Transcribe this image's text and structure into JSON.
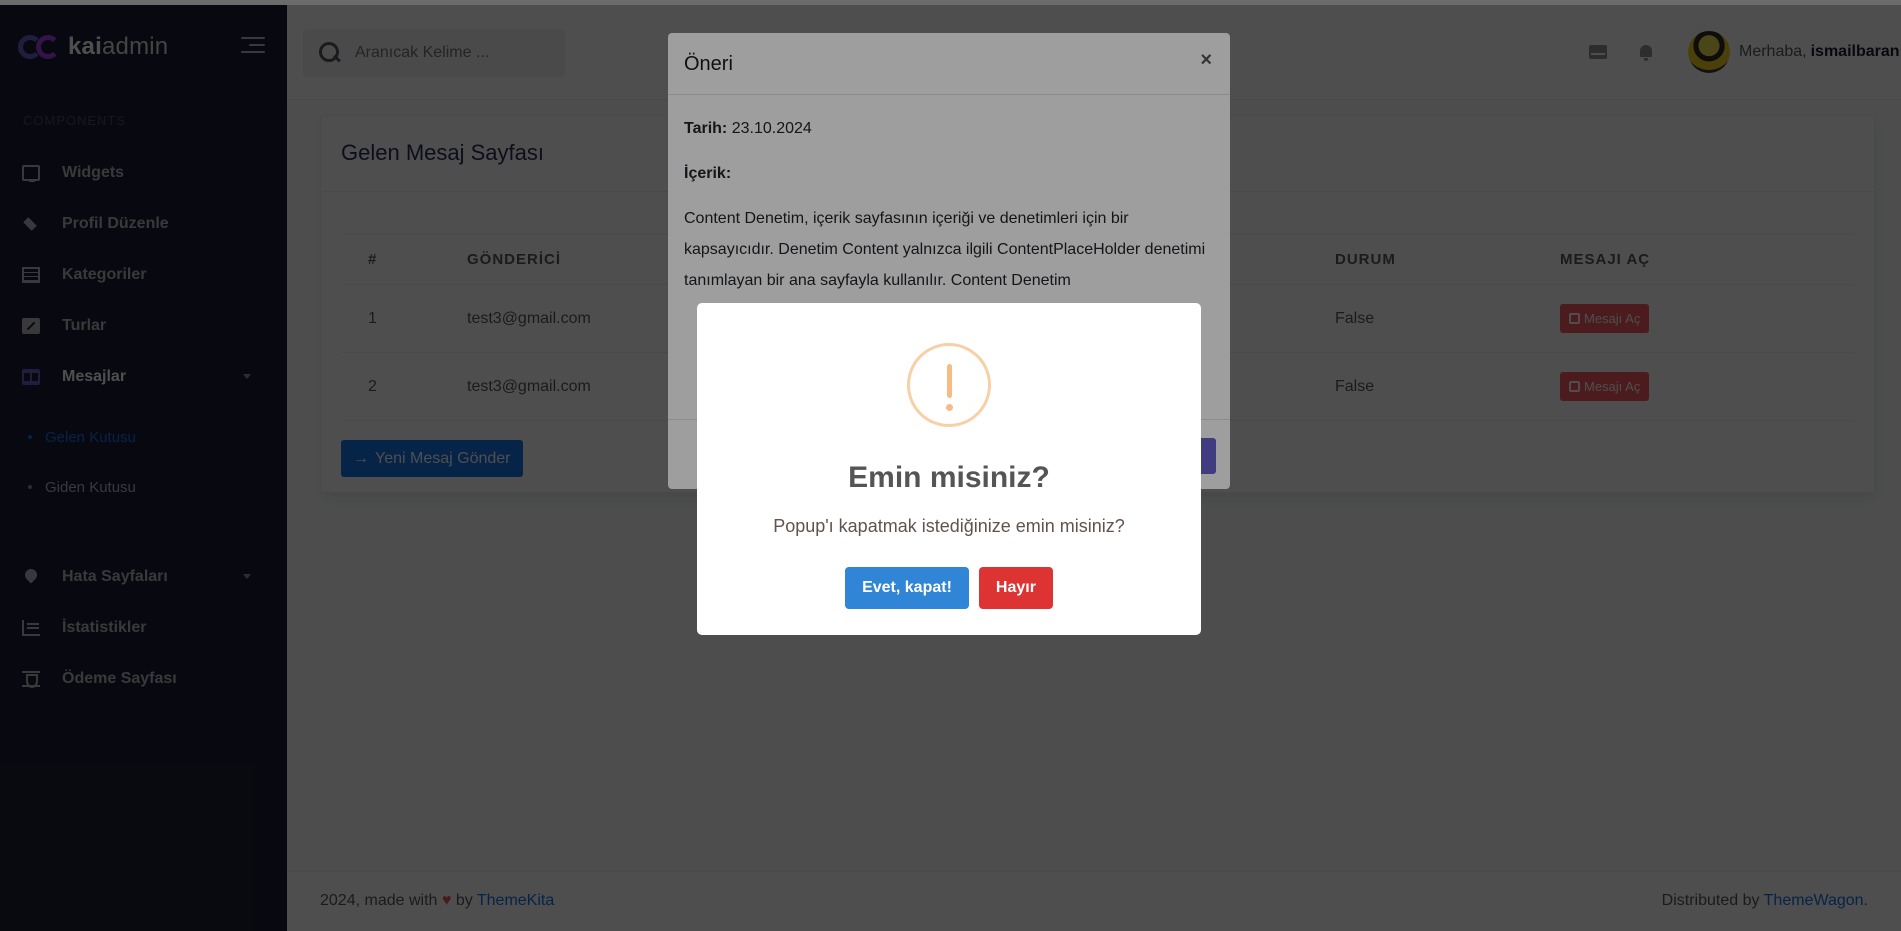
{
  "brand": {
    "logo_bold": "kai",
    "logo_light": "admin"
  },
  "sidebar": {
    "section_label": "COMPONENTS",
    "items": [
      {
        "label": "Widgets",
        "icon": "monitor-icon"
      },
      {
        "label": "Profil Düzenle",
        "icon": "layers-icon"
      },
      {
        "label": "Kategoriler",
        "icon": "table-icon"
      },
      {
        "label": "Turlar",
        "icon": "edit-icon"
      },
      {
        "label": "Mesajlar",
        "icon": "grid-icon"
      }
    ],
    "submenu": [
      {
        "label": "Gelen Kutusu"
      },
      {
        "label": "Giden Kutusu"
      }
    ],
    "items2": [
      {
        "label": "Hata Sayfaları",
        "icon": "map-pin-icon"
      },
      {
        "label": "İstatistikler",
        "icon": "chart-icon"
      },
      {
        "label": "Ödeme Sayfası",
        "icon": "hourglass-icon"
      }
    ]
  },
  "header": {
    "search_placeholder": "Aranıcak Kelime ...",
    "greeting": "Merhaba,",
    "username": "ismailbaran"
  },
  "card": {
    "title": "Gelen Mesaj Sayfası",
    "columns": [
      "#",
      "GÖNDERİCİ",
      "DURUM",
      "MESAJI AÇ"
    ],
    "rows": [
      {
        "num": "1",
        "sender": "test3@gmail.com",
        "status": "False",
        "action": "Mesajı Aç"
      },
      {
        "num": "2",
        "sender": "test3@gmail.com",
        "status": "False",
        "action": "Mesajı Aç"
      }
    ],
    "new_button": "Yeni Mesaj Gönder"
  },
  "footer": {
    "left_prefix": "2024, made with",
    "left_by": "by",
    "left_link": "ThemeKita",
    "right_prefix": "Distributed by",
    "right_link": "ThemeWagon",
    "right_suffix": "."
  },
  "modal": {
    "title": "Öneri",
    "close": "×",
    "date_label": "Tarih:",
    "date_value": "23.10.2024",
    "content_label": "İçerik:",
    "content_text": "Content Denetim, içerik sayfasının içeriği ve denetimleri için bir kapsayıcıdır. Denetim Content yalnızca ilgili ContentPlaceHolder denetimi tanımlayan bir ana sayfayla kullanılır. Content Denetim"
  },
  "alert": {
    "title": "Emin misiniz?",
    "text": "Popup'ı kapatmak istediğinize emin misiniz?",
    "confirm": "Evet, kapat!",
    "cancel": "Hayır"
  },
  "colors": {
    "sidebar_bg": "#1a2035",
    "primary": "#1572e8",
    "secondary": "#6861ce",
    "danger": "#f25961",
    "confirm": "#3085d6",
    "cancel": "#dd3333"
  }
}
